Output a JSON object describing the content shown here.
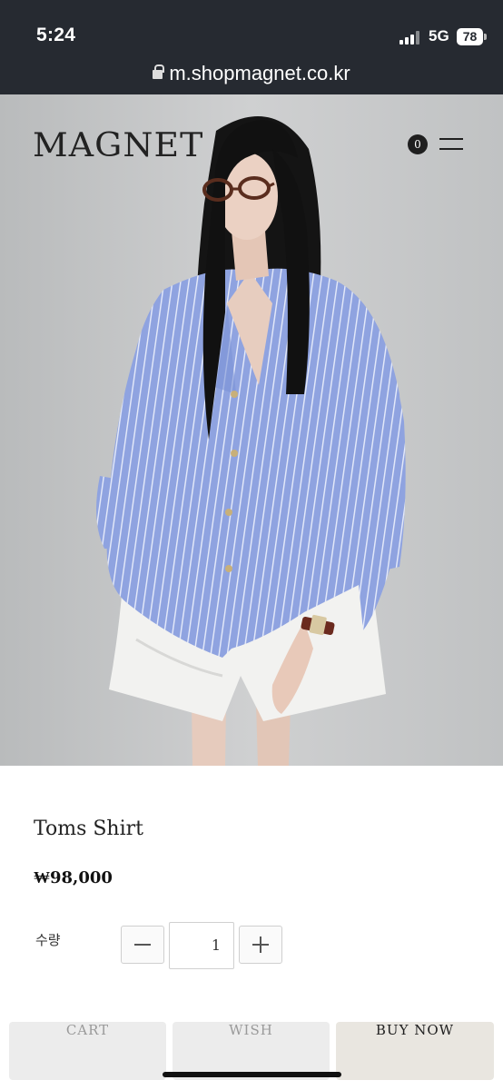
{
  "status_bar": {
    "time": "5:24",
    "network": "5G",
    "battery": "78",
    "icons": [
      "signal-icon",
      "battery-icon"
    ]
  },
  "browser": {
    "url": "m.shopmagnet.co.kr",
    "lock_icon": "lock-icon"
  },
  "header": {
    "logo": "MAGNET",
    "cart_count": "0",
    "menu_icon": "hamburger-menu-icon"
  },
  "product": {
    "name": "Toms Shirt",
    "price": "₩98,000",
    "quantity_label": "수량",
    "quantity_value": "1"
  },
  "actions": {
    "cart_label": "CART",
    "wish_label": "WISH",
    "buy_label": "BUY NOW"
  },
  "colors": {
    "status_bar_bg": "#262a31",
    "shirt_blue": "#8fa3e0",
    "buy_button_bg": "#e9e6e0",
    "secondary_button_bg": "#ececec"
  }
}
